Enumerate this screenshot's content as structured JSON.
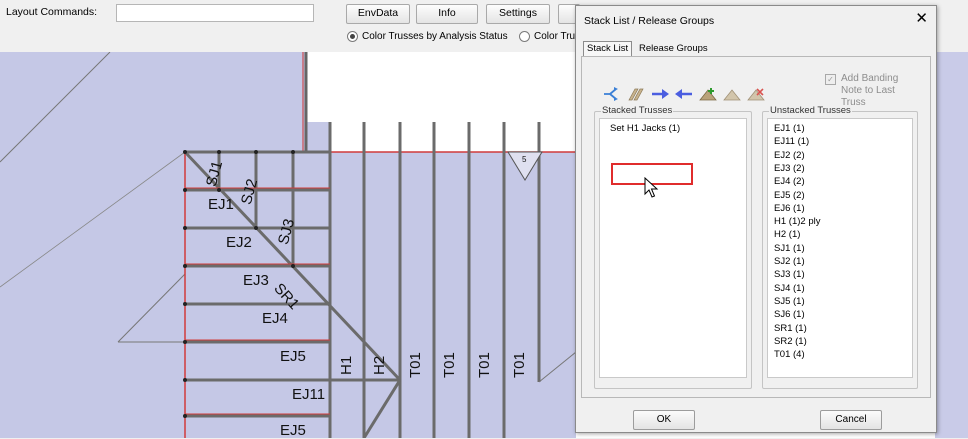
{
  "toolbar": {
    "layout_label": "Layout Commands:",
    "layout_input_value": "",
    "buttons": {
      "envdata": "EnvData",
      "info": "Info",
      "settings": "Settings"
    },
    "radio_color_by_status": "Color Trusses by Analysis Status",
    "radio_color_other": "Color Trusses"
  },
  "plan": {
    "labels": {
      "sj1": "SJ1",
      "sj2": "SJ2",
      "sj3": "SJ3",
      "sr1": "SR1",
      "ej1": "EJ1",
      "ej2": "EJ2",
      "ej3": "EJ3",
      "ej4": "EJ4",
      "ej5a": "EJ5",
      "ej11": "EJ11",
      "ej5b": "EJ5",
      "h1": "H1",
      "h2": "H2",
      "t01a": "T01",
      "t01b": "T01",
      "t01c": "T01",
      "t01d": "T01",
      "marker": "5"
    }
  },
  "dialog": {
    "title": "Stack List / Release Groups",
    "close": "✕",
    "tabs": {
      "stack_list": "Stack List",
      "release_groups": "Release Groups"
    },
    "toolbar_icons": [
      "split-icon",
      "stack-icon",
      "arrow-right-icon",
      "arrow-left-icon",
      "add-truss-icon",
      "truss-icon",
      "truss-remove-icon"
    ],
    "banding_note": "Add Banding Note to Last Truss",
    "banding_checked": true,
    "stacked_title": "Stacked Trusses",
    "stacked_items": [
      "Set H1 Jacks (1)"
    ],
    "unstacked_title": "Unstacked Trusses",
    "unstacked_items": [
      "EJ1 (1)",
      "EJ11 (1)",
      "EJ2 (2)",
      "EJ3 (2)",
      "EJ4 (2)",
      "EJ5 (2)",
      "EJ6 (1)",
      "H1 (1)2 ply",
      "H2 (1)",
      "SJ1 (1)",
      "SJ2 (1)",
      "SJ3 (1)",
      "SJ4 (1)",
      "SJ5 (1)",
      "SJ6 (1)",
      "SR1 (1)",
      "SR2 (1)",
      "T01 (4)"
    ],
    "ok": "OK",
    "cancel": "Cancel"
  },
  "colors": {
    "plan_fill": "#c5c8e6",
    "truss_member": "#6b6b6b",
    "highlight": "#e02c2c",
    "dialog_bg": "#f0f0f0"
  }
}
